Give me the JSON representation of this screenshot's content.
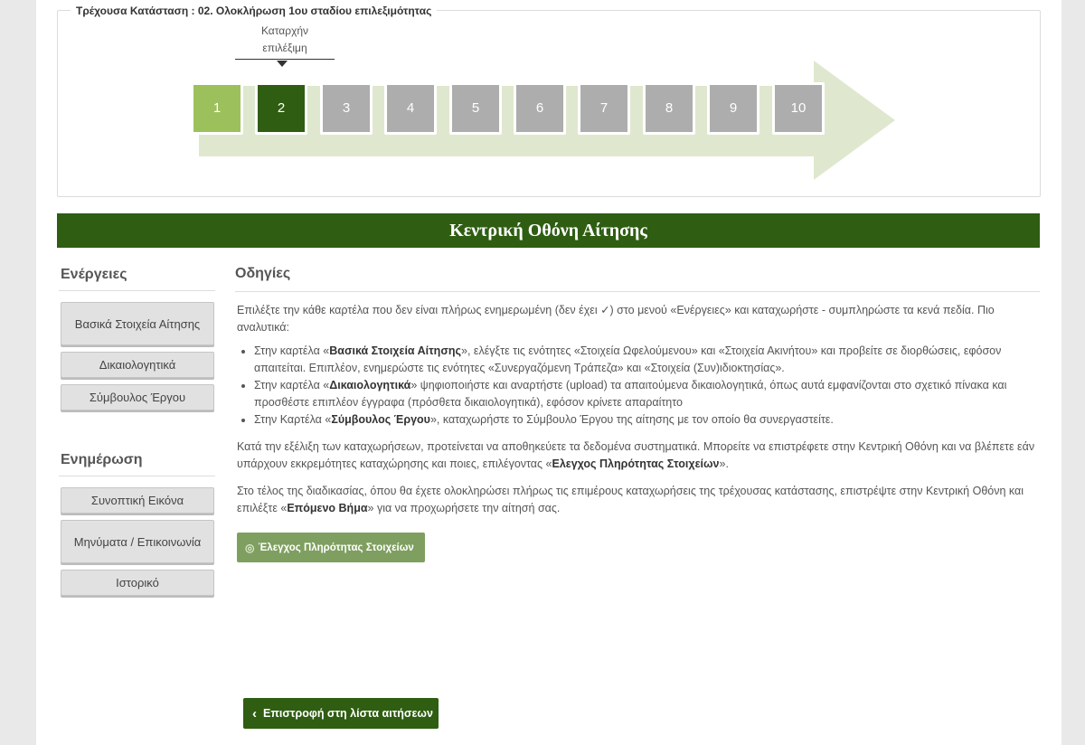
{
  "status": {
    "legend": "Τρέχουσα Κατάσταση : 02. Ολοκλήρωση 1ου σταδίου επιλεξιμότητας",
    "tooltip_line1": "Καταρχήν",
    "tooltip_line2": "επιλέξιμη",
    "steps": [
      {
        "label": "1",
        "state": "done"
      },
      {
        "label": "2",
        "state": "current"
      },
      {
        "label": "3",
        "state": "pending"
      },
      {
        "label": "4",
        "state": "pending"
      },
      {
        "label": "5",
        "state": "pending"
      },
      {
        "label": "6",
        "state": "pending"
      },
      {
        "label": "7",
        "state": "pending"
      },
      {
        "label": "8",
        "state": "pending"
      },
      {
        "label": "9",
        "state": "pending"
      },
      {
        "label": "10",
        "state": "pending"
      }
    ],
    "colors": {
      "done": "#9cc05c",
      "current": "#2f5d12",
      "pending": "#adadad",
      "arrow": "#dfe8cf"
    }
  },
  "header": {
    "title": "Κεντρική Οθόνη Αίτησης"
  },
  "sidebar": {
    "actions_title": "Ενέργειες",
    "actions": [
      {
        "label": "Βασικά Στοιχεία Αίτησης"
      },
      {
        "label": "Δικαιολογητικά"
      },
      {
        "label": "Σύμβουλος Έργου"
      }
    ],
    "updates_title": "Ενημέρωση",
    "updates": [
      {
        "label": "Συνοπτική Εικόνα"
      },
      {
        "label": "Μηνύματα / Επικοινωνία"
      },
      {
        "label": "Ιστορικό"
      }
    ]
  },
  "content": {
    "title": "Οδηγίες",
    "intro": "Επιλέξτε την κάθε καρτέλα που δεν είναι πλήρως ενημερωμένη (δεν έχει ✓) στο μενού «Ενέργειες» και καταχωρήστε - συμπληρώστε τα κενά πεδία. Πιο αναλυτικά:",
    "bullets": [
      {
        "pre": "Στην καρτέλα «",
        "bold": "Βασικά Στοιχεία Αίτησης",
        "post": "», ελέγξτε τις ενότητες «Στοιχεία Ωφελούμενου» και «Στοιχεία Ακινήτου» και προβείτε σε διορθώσεις, εφόσον απαιτείται. Επιπλέον, ενημερώστε τις ενότητες «Συνεργαζόμενη Τράπεζα» και «Στοιχεία (Συν)ιδιοκτησίας»."
      },
      {
        "pre": "Στην καρτέλα «",
        "bold": "Δικαιολογητικά",
        "post": "» ψηφιοποιήστε και αναρτήστε (upload) τα απαιτούμενα δικαιολογητικά, όπως αυτά εμφανίζονται στο σχετικό πίνακα και προσθέστε επιπλέον έγγραφα (πρόσθετα δικαιολογητικά), εφόσον κρίνετε απαραίτητο"
      },
      {
        "pre": "Στην Καρτέλα «",
        "bold": "Σύμβουλος Έργου",
        "post": "», καταχωρήστε το Σύμβουλο Έργου της αίτησης με τον οποίο θα συνεργαστείτε."
      }
    ],
    "para2_pre": "Κατά την εξέλιξη των καταχωρήσεων, προτείνεται να αποθηκεύετε τα δεδομένα συστηματικά. Μπορείτε να επιστρέφετε στην Κεντρική Οθόνη και να βλέπετε εάν υπάρχουν εκκρεμότητες καταχώρησης και ποιες, επιλέγοντας «",
    "para2_bold": "Ελεγχος Πληρότητας Στοιχείων",
    "para2_post": "».",
    "para3_pre": "Στο τέλος της διαδικασίας, όπου θα έχετε ολοκληρώσει πλήρως τις επιμέρους καταχωρήσεις της τρέχουσας κατάστασης, επιστρέψτε στην Κεντρική Οθόνη και επιλέξτε «",
    "para3_bold": "Επόμενο Βήμα",
    "para3_post": "» για να προχωρήσετε την αίτησή σας.",
    "check_button": "Έλεγχος Πληρότητας Στοιχείων"
  },
  "footer": {
    "back_button": "Επιστροφή στη λίστα αιτήσεων"
  }
}
